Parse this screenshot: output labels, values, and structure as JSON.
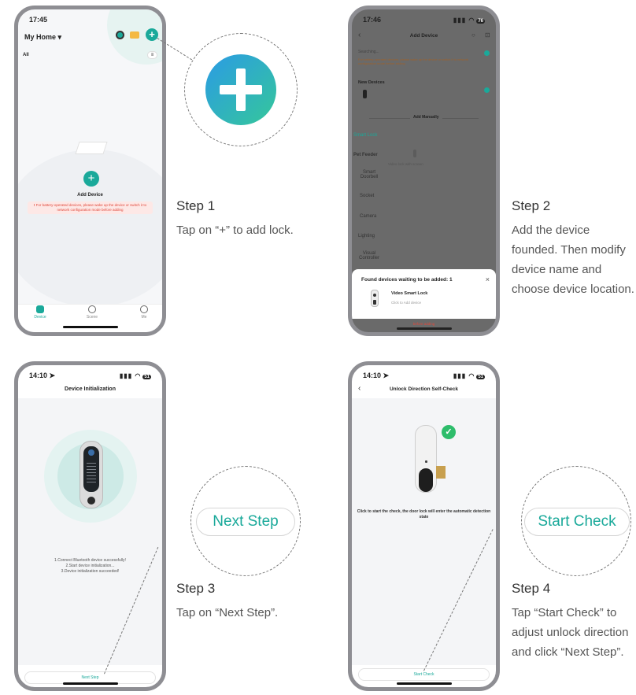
{
  "colors": {
    "accent": "#1aa99a",
    "plus_gradient_start": "#2b9be5",
    "plus_gradient_end": "#35c79a",
    "overlay": "#6a6a6a",
    "warning": "#e0483b"
  },
  "step1": {
    "phone": {
      "time": "17:45",
      "battery": "76",
      "home_title": "My Home ▾",
      "filter": "All",
      "add_device": "Add Device",
      "warning_text": "For battery-operated devices, please wake up the device or switch it to network configuration mode before adding",
      "tabs": [
        "Device",
        "Scene",
        "Me"
      ]
    },
    "title": "Step 1",
    "desc": "Tap on “+” to add lock."
  },
  "step2": {
    "phone": {
      "time": "17:46",
      "battery": "76",
      "header": "Add Device",
      "searching": "Searching...",
      "hint": "For battery-operated devices, please wake up the device or switch it to network configuration mode before adding",
      "new_devices": "New Devices",
      "add_manually": "Add Manually",
      "categories": [
        "Smart Lock",
        "Pet Feeder",
        "Smart Doorbell",
        "Socket",
        "Camera",
        "Lighting",
        "Visual Controller"
      ],
      "video_lock_label": "Video lock with screen",
      "popup_title": "Found devices waiting to be added: 1",
      "popup_close": "×",
      "device_name": "Video Smart Lock",
      "device_sub": "Click to Add device",
      "bottom_hint": "before adding"
    },
    "title": "Step 2",
    "desc": "Add the device founded. Then modify device name and choose device location."
  },
  "step3": {
    "phone": {
      "time": "14:10 ➤",
      "battery": "51",
      "header": "Device Initialization",
      "lines": [
        "1.Connect Bluetooth device successfully!",
        "2.Start device initialization...",
        "3.Device initialization succeeded!"
      ],
      "button": "Next Step"
    },
    "callout": "Next Step",
    "title": "Step 3",
    "desc": "Tap on “Next Step”."
  },
  "step4": {
    "phone": {
      "time": "14:10 ➤",
      "battery": "51",
      "header": "Unlock Direction Self-Check",
      "instruction": "Click to start the check, the door lock will enter the automatic detection state",
      "button": "Start Check"
    },
    "callout": "Start Check",
    "title": "Step 4",
    "desc": "Tap “Start Check” to adjust unlock direction and click “Next Step”."
  }
}
